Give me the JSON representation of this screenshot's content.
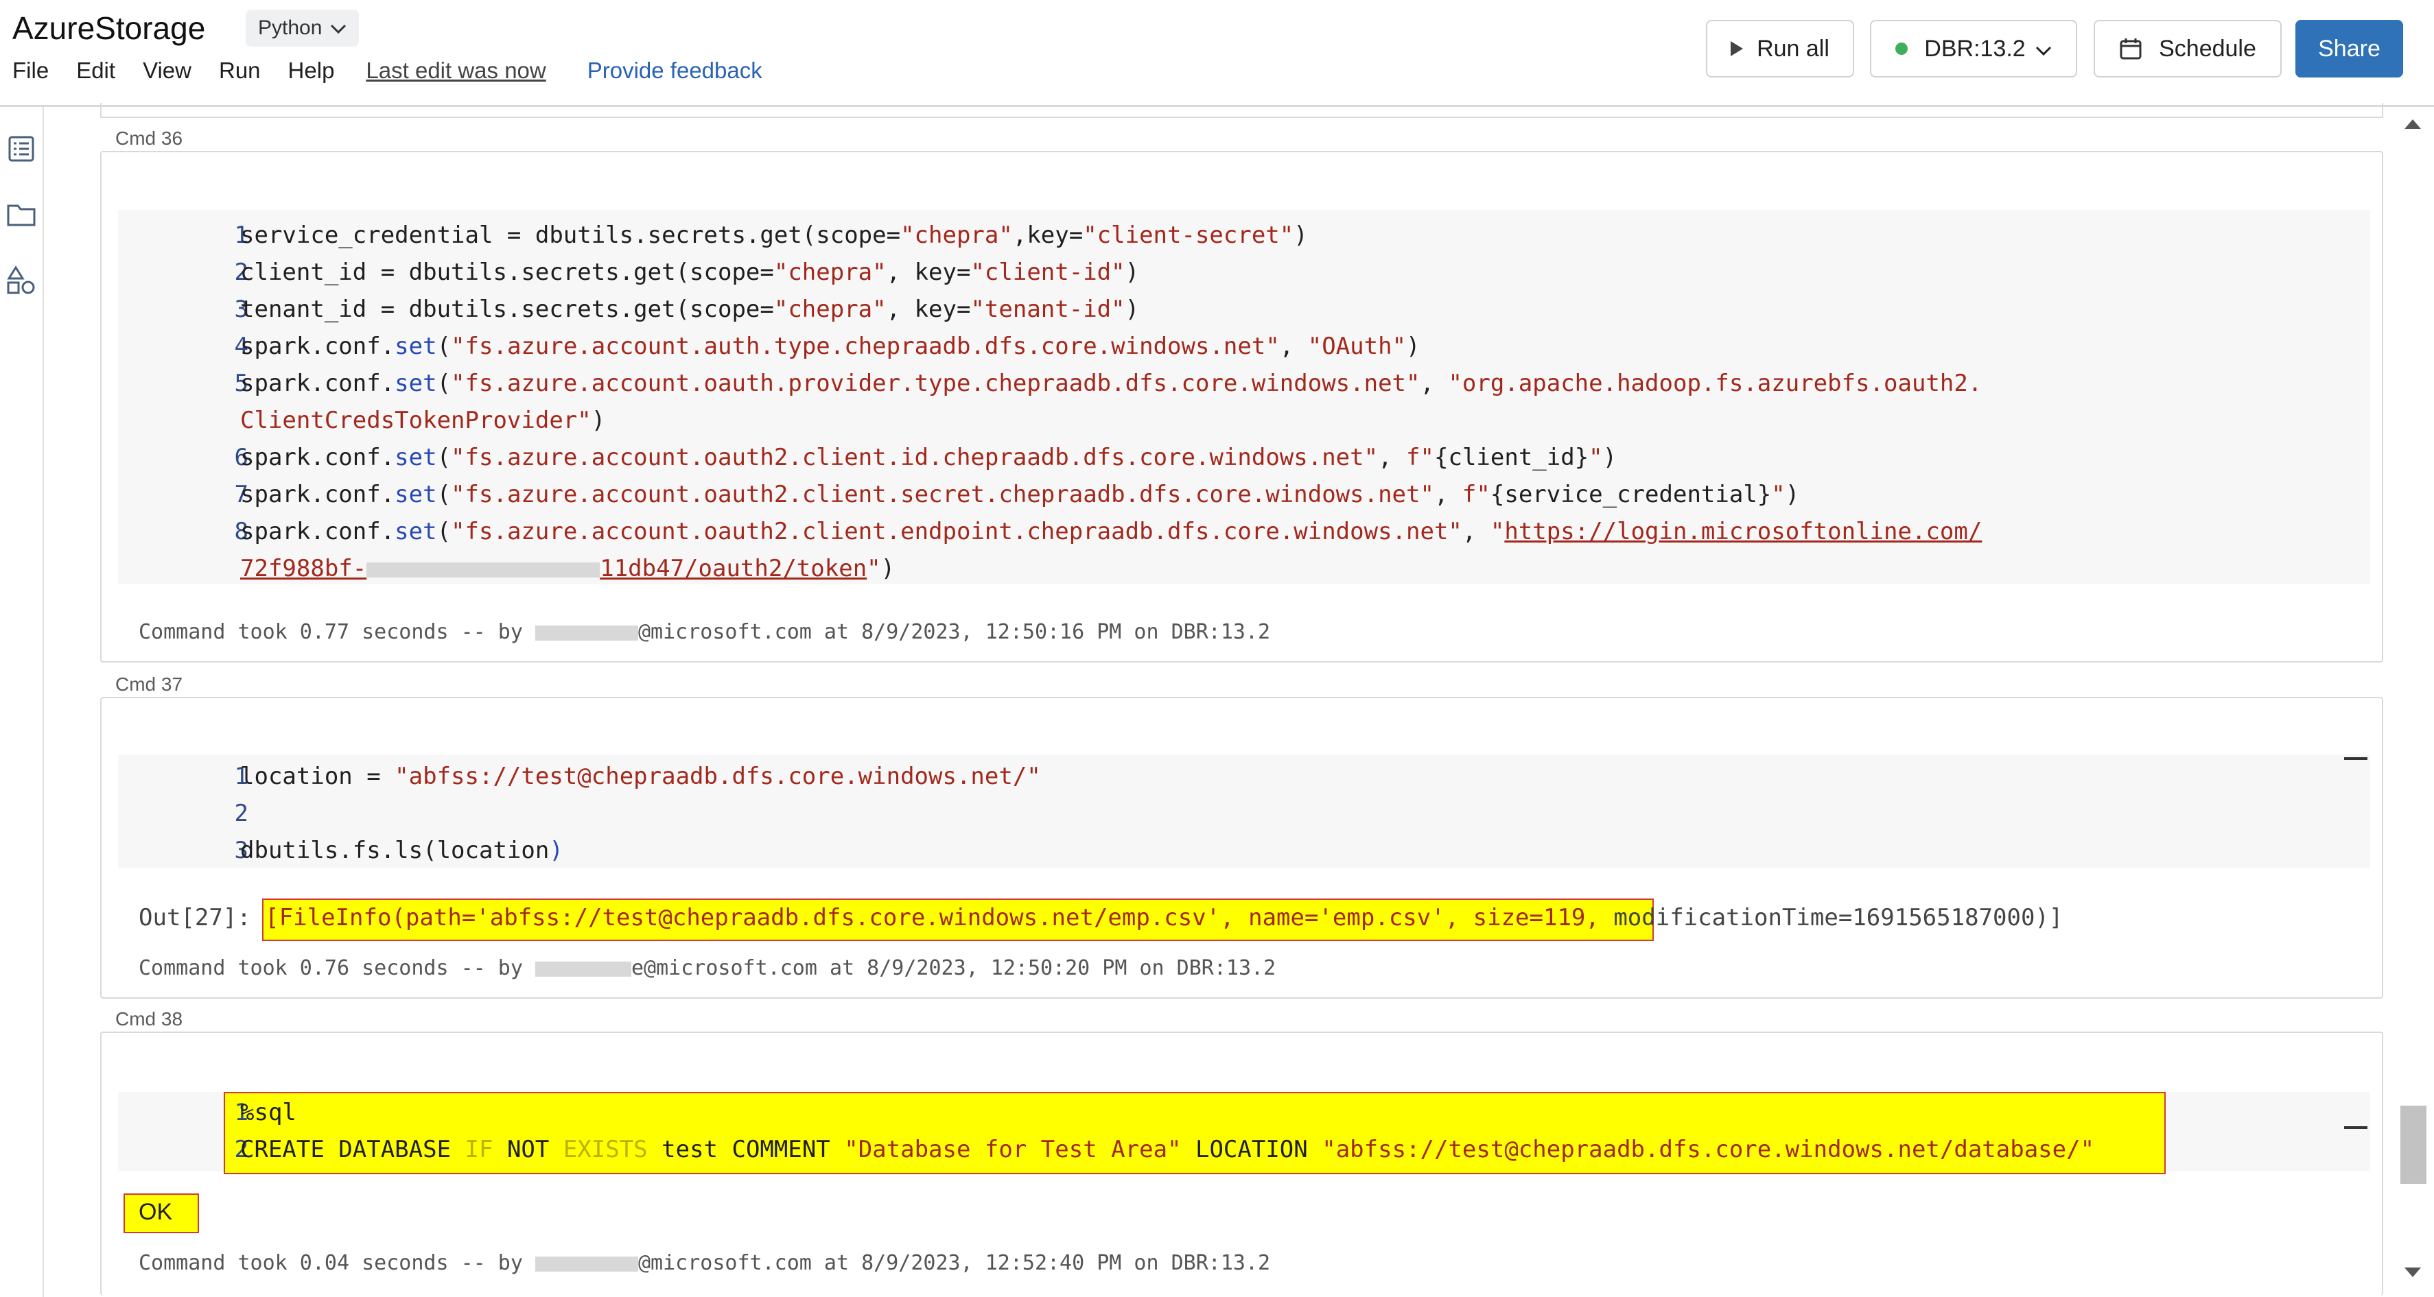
{
  "app": {
    "title": "AzureStorage",
    "language": "Python"
  },
  "menu": {
    "file": "File",
    "edit": "Edit",
    "view": "View",
    "run": "Run",
    "help": "Help",
    "last_edit": "Last edit was now",
    "feedback": "Provide feedback"
  },
  "toolbar": {
    "run_all": "Run all",
    "cluster": "DBR:13.2",
    "schedule": "Schedule",
    "share": "Share"
  },
  "colors": {
    "share_bg": "#2f72b8",
    "highlight": "#ffff00",
    "highlight_border": "#d23a3a",
    "cluster_dot": "#3fae5a"
  },
  "cmd36": {
    "label": "Cmd 36",
    "status": "Command took 0.77 seconds -- by ",
    "status_tail": "@microsoft.com at 8/9/2023, 12:50:16 PM on DBR:13.2"
  },
  "cmd37": {
    "label": "Cmd 37",
    "out_prefix": "Out[27]: ",
    "out_highlight": "[FileInfo(path='abfss://test@chepraadb.dfs.core.windows.net/emp.csv', name='emp.csv', size=119,",
    "out_rest": " modificationTime=1691565187000)]",
    "status": "Command took 0.76 seconds -- by ",
    "status_tail": "e@microsoft.com at 8/9/2023, 12:50:20 PM on DBR:13.2"
  },
  "cmd38": {
    "label": "Cmd 38",
    "result": "OK",
    "status": "Command took 0.04 seconds -- by ",
    "status_tail": "@microsoft.com at 8/9/2023, 12:52:40 PM on DBR:13.2"
  },
  "line_numbers": [
    "1",
    "2",
    "3",
    "4",
    "5",
    "6",
    "7",
    "8"
  ]
}
